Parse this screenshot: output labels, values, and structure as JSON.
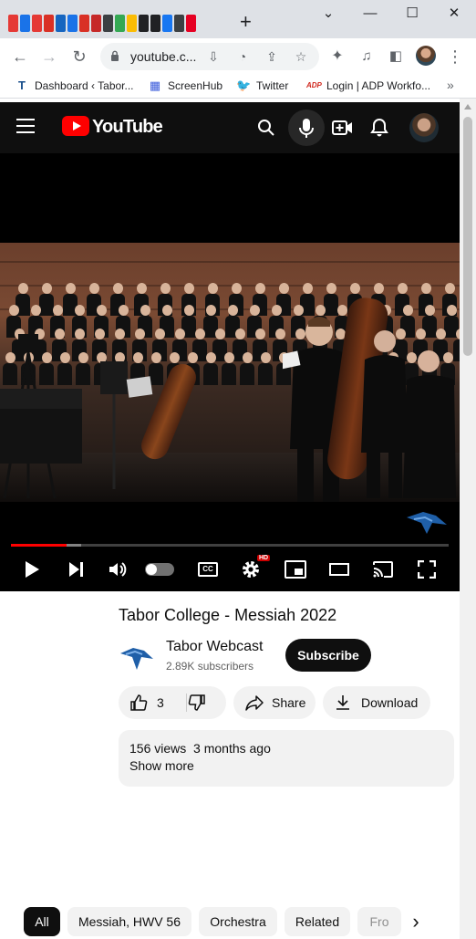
{
  "browser": {
    "tab_favicons": [
      {
        "name": "tab-favicon-1",
        "color": "#e53935"
      },
      {
        "name": "tab-favicon-2",
        "color": "#1a73e8"
      },
      {
        "name": "tab-favicon-3",
        "color": "#e53935"
      },
      {
        "name": "tab-favicon-4",
        "color": "#d93025"
      },
      {
        "name": "tab-favicon-5",
        "color": "#1565c0"
      },
      {
        "name": "tab-favicon-6",
        "color": "#1a73e8"
      },
      {
        "name": "tab-favicon-7",
        "color": "#d93025"
      },
      {
        "name": "tab-favicon-8",
        "color": "#c62828"
      },
      {
        "name": "tab-favicon-9",
        "color": "#3c4043"
      },
      {
        "name": "tab-favicon-10",
        "color": "#34a853"
      },
      {
        "name": "tab-favicon-11",
        "color": "#fbbc04"
      },
      {
        "name": "tab-favicon-12",
        "color": "#202124"
      },
      {
        "name": "tab-favicon-13",
        "color": "#202124"
      },
      {
        "name": "tab-favicon-14",
        "color": "#1877f2"
      },
      {
        "name": "tab-favicon-15",
        "color": "#3c4043"
      },
      {
        "name": "tab-favicon-16",
        "color": "#e60023"
      }
    ],
    "new_tab_glyph": "+",
    "window_controls": {
      "minimize": "—",
      "maximize": "☐",
      "close": "✕",
      "dropdown": "⌄"
    },
    "nav": {
      "back": "←",
      "forward": "→",
      "reload": "↻",
      "menu": "⋮"
    },
    "address": {
      "url": "youtube.c..."
    },
    "bookmarks": [
      {
        "label": "Dashboard ‹ Tabor...",
        "icon": "tabor-icon",
        "glyph": "T",
        "color": "#1a4f8b"
      },
      {
        "label": "ScreenHub",
        "icon": "grid-icon",
        "glyph": "▦",
        "color": "#3b5bdb"
      },
      {
        "label": "Twitter",
        "icon": "twitter-icon",
        "glyph": "🐦",
        "color": "#1d9bf0"
      },
      {
        "label": "Login | ADP Workfo...",
        "icon": "adp-icon",
        "glyph": "ADP",
        "color": "#d0271d"
      }
    ],
    "bookmarks_more": "»"
  },
  "youtube": {
    "brand": "YouTube",
    "brand_color": "#ff0000",
    "player": {
      "progress_played": 0.127,
      "progress_loaded": 0.16,
      "hd_badge": "HD",
      "cc_label": "CC"
    },
    "video": {
      "title": "Tabor College - Messiah 2022",
      "channel": "Tabor Webcast",
      "subscribers": "2.89K subscribers",
      "subscribe_label": "Subscribe",
      "likes": "3",
      "share_label": "Share",
      "download_label": "Download",
      "stats": "156 views  3 months ago",
      "show_more": "Show more"
    },
    "chips": [
      "All",
      "Messiah, HWV 56",
      "Orchestra",
      "Related",
      "Fro"
    ],
    "chip_next": "›"
  }
}
